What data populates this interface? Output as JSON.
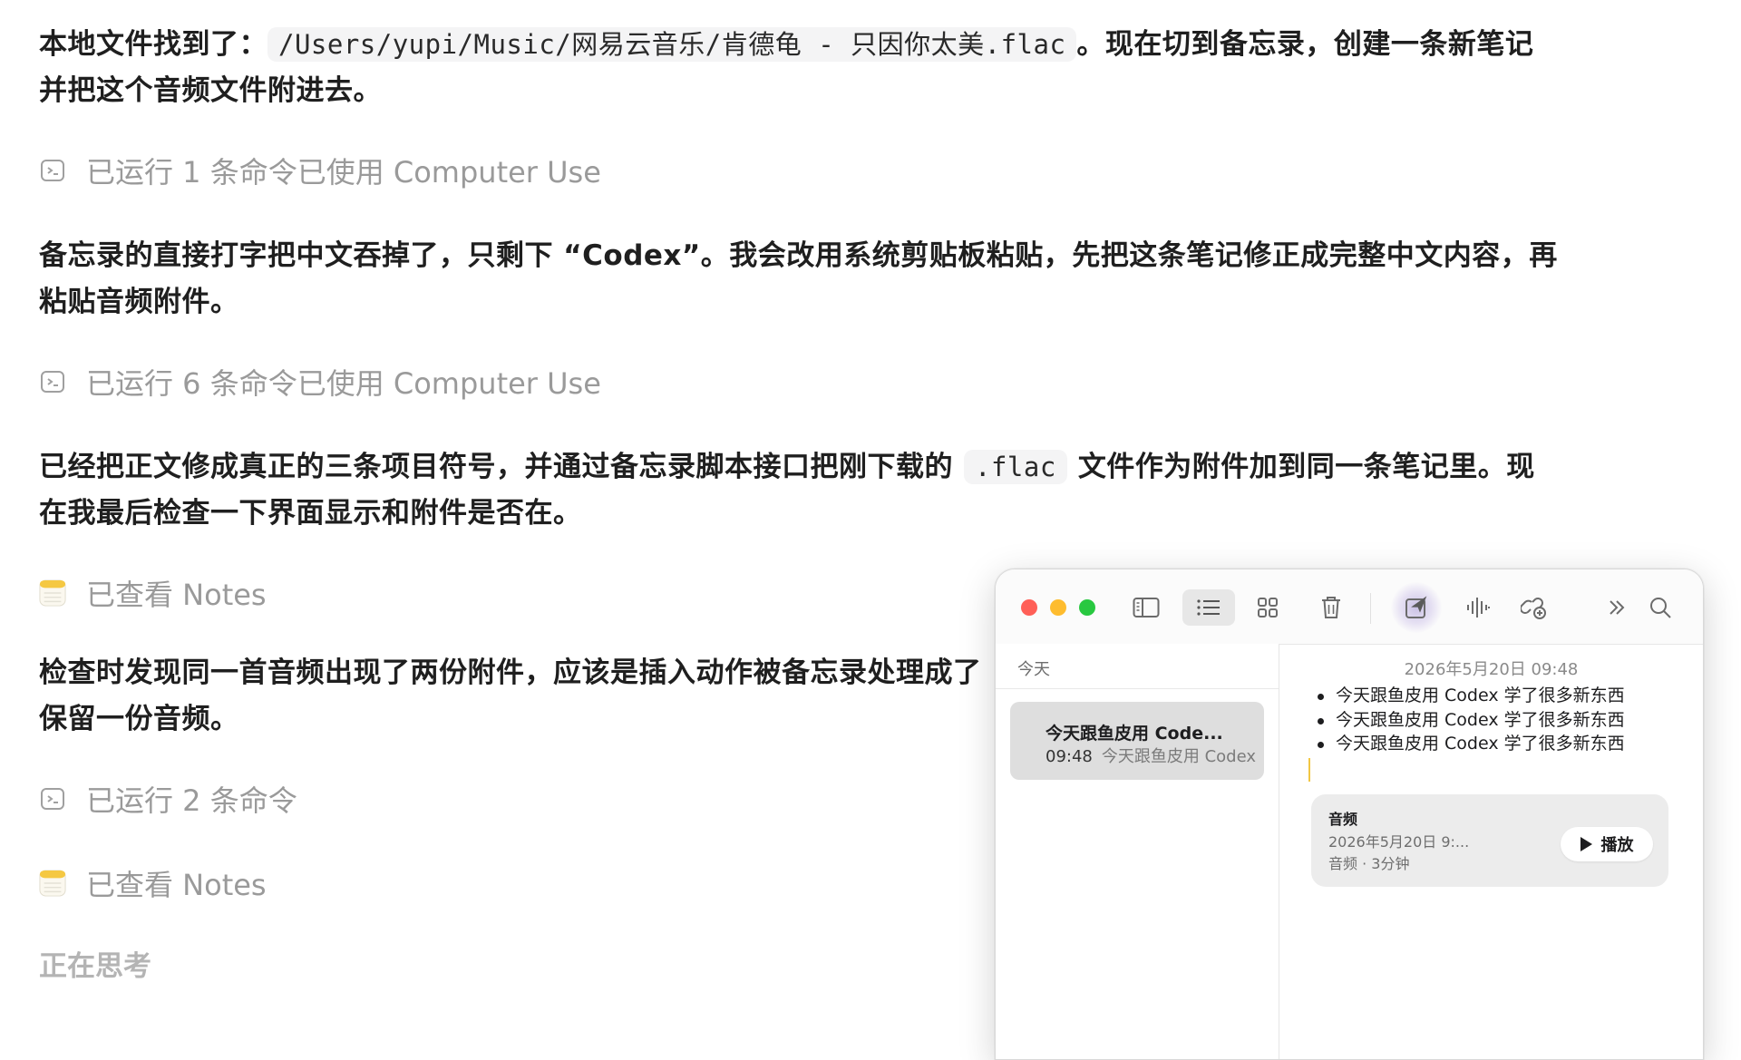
{
  "chat": {
    "p1_before": "本地文件找到了：",
    "p1_code": "/Users/yupi/Music/网易云音乐/肯德龟 - 只因你太美.flac",
    "p1_after": "。现在切到备忘录，创建一条新笔记",
    "p1_line2": "并把这个音频文件附进去。",
    "action1": "已运行 1 条命令已使用 Computer Use",
    "p2_line1": "备忘录的直接打字把中文吞掉了，只剩下 “Codex”。我会改用系统剪贴板粘贴，先把这条笔记修正成完整中文内容，再",
    "p2_line2": "粘贴音频附件。",
    "action2": "已运行 6 条命令已使用 Computer Use",
    "p3_before": "已经把正文修成真正的三条项目符号，并通过备忘录脚本接口把刚下载的",
    "p3_code": ".flac",
    "p3_after": "文件作为附件加到同一条笔记里。现",
    "p3_line2": "在我最后检查一下界面显示和附件是否在。",
    "action3": "已查看 Notes",
    "p4_line1": "检查时发现同一首音频出现了两份附件，应该是插入动作被备忘录处理成了",
    "p4_line2": "保留一份音频。",
    "action4": "已运行 2 条命令",
    "action5": "已查看 Notes",
    "thinking": "正在思考"
  },
  "notes_window": {
    "section_header": "今天",
    "note_title": "今天跟鱼皮用 Code...",
    "note_time": "09:48",
    "note_preview": "今天跟鱼皮用 Codex",
    "editor_date": "2026年5月20日 09:48",
    "bullets": [
      "今天跟鱼皮用 Codex 学了很多新东西",
      "今天跟鱼皮用 Codex 学了很多新东西",
      "今天跟鱼皮用 Codex 学了很多新东西"
    ],
    "attachment": {
      "title": "音频",
      "date": "2026年5月20日 9:...",
      "meta": "音频 · 3分钟",
      "play_label": "播放"
    },
    "icons": [
      "sidebar-toggle-icon",
      "list-view-icon",
      "gallery-view-icon",
      "trash-icon",
      "compose-icon",
      "audio-waveform-icon",
      "collaborate-icon",
      "more-icon",
      "search-icon"
    ]
  },
  "colors": {
    "close": "#ff5f57",
    "minimize": "#febc2e",
    "zoom": "#28c840",
    "selected_note": "#dedede",
    "muted_text": "#9a9a9a"
  }
}
